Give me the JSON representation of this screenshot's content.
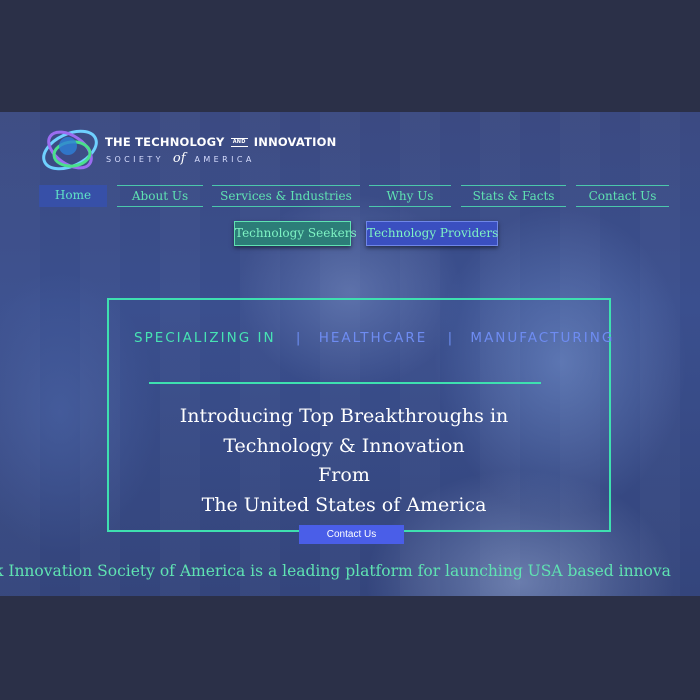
{
  "brand": {
    "title_left": "THE TECHNOLOGY",
    "title_and": "AND",
    "title_right": "INNOVATION",
    "sub_left": "SOCIETY",
    "sub_of": "of",
    "sub_right": "AMERICA",
    "logo_icon": "orbit-rings-logo"
  },
  "nav": {
    "items": [
      "Home",
      "About Us",
      "Services & Industries",
      "Why Us",
      "Stats & Facts",
      "Contact Us"
    ],
    "active": "Home"
  },
  "sub_buttons": {
    "seekers": "Technology Seekers",
    "providers": "Technology Providers"
  },
  "hero": {
    "specializing": "SPECIALIZING IN",
    "separator": "|",
    "healthcare": "HEALTHCARE",
    "manufacturing": "MANUFACTURING",
    "line1": "Introducing Top Breakthroughs in",
    "line2": "Technology & Innovation",
    "line3": "From",
    "line4": "The United States of America",
    "contact_button": "Contact Us"
  },
  "ticker": {
    "text": "k Innovation Society of America is a leading platform for launching USA based innova"
  },
  "colors": {
    "accent_green": "#3ee0b0",
    "accent_blue": "#4a5ee8",
    "page_background": "#2b3048"
  }
}
